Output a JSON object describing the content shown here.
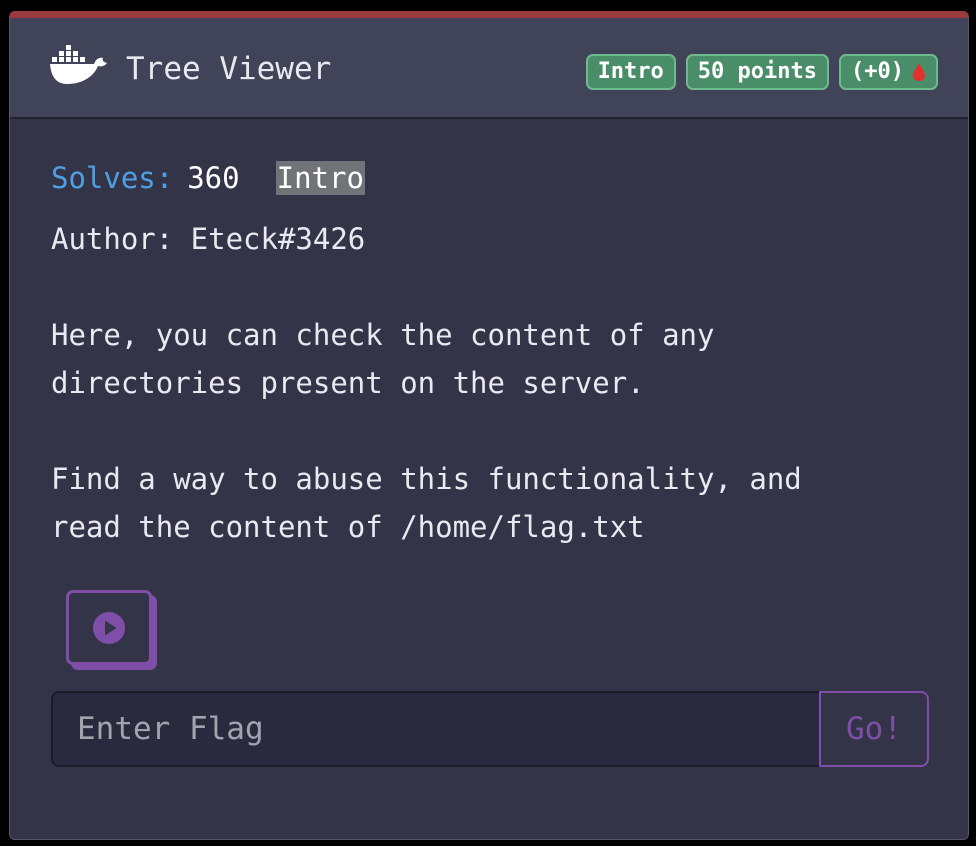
{
  "header": {
    "icon": "docker-whale-icon",
    "title": "Tree Viewer",
    "badges": {
      "category": "Intro",
      "points": "50 points",
      "bonus": "(+0)",
      "bonus_icon": "blood-drop-icon"
    }
  },
  "body": {
    "solves_label": "Solves:",
    "solves_value": "360",
    "category_tag": "Intro",
    "author": "Author: Eteck#3426",
    "description": [
      "Here, you can check the content of any",
      "directories present on the server.",
      "Find a way to abuse this functionality, and",
      "read the content of /home/flag.txt"
    ]
  },
  "actions": {
    "play_icon": "play-circle-icon",
    "flag_placeholder": "Enter Flag",
    "submit_label": "Go!"
  },
  "colors": {
    "accent": "#7e4ea8",
    "badge": "#4a8d69",
    "top_bar": "#9b3a3f",
    "solves_label": "#4fa0e3"
  }
}
